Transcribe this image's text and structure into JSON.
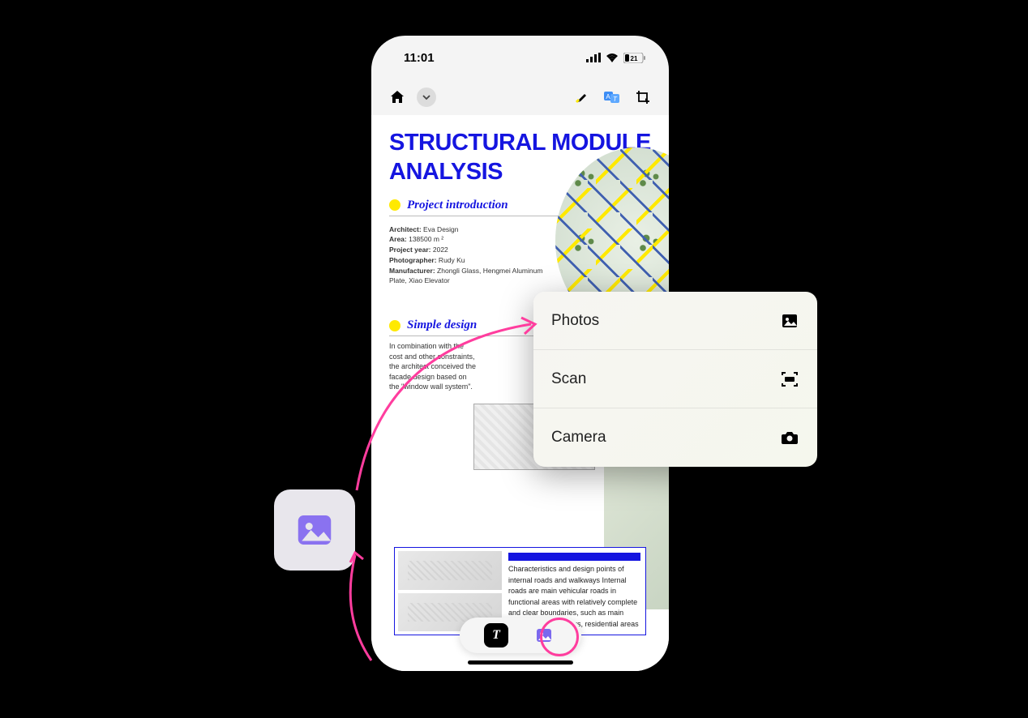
{
  "statusbar": {
    "time": "11:01",
    "battery": "21"
  },
  "document": {
    "title_line1": "STRUCTURAL MODULE",
    "title_line2": "ANALYSIS",
    "section1_title": "Project introduction",
    "meta": {
      "architect_k": "Architect:",
      "architect_v": " Eva Design",
      "area_k": "Area:",
      "area_v": " 138500 m ²",
      "year_k": "Project year:",
      "year_v": " 2022",
      "photo_k": "Photographer:",
      "photo_v": " Rudy Ku",
      "manu_k": "Manufacturer:",
      "manu_v": " Zhongli Glass, Hengmei Aluminum Plate, Xiao Elevator"
    },
    "section2_title": "Simple design",
    "section2_body": "In combination with the cost and other constraints, the architect conceived the facade design based on the \"window wall system\".",
    "bottom_body": "Characteristics and design points of internal roads and walkways Internal roads are main vehicular roads in functional areas with relatively complete and clear boundaries, such as main roads in urban centers, residential areas"
  },
  "popup": {
    "photos": "Photos",
    "scan": "Scan",
    "camera": "Camera"
  },
  "pill": {
    "text_glyph": "T"
  }
}
